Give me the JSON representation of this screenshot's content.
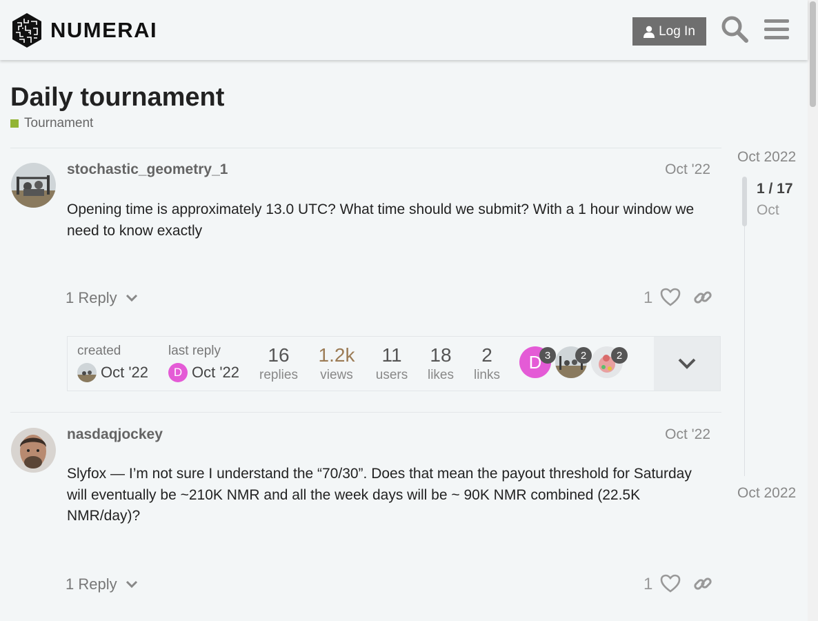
{
  "header": {
    "brand": "NUMERAI",
    "login_label": "Log In",
    "search_icon": "search-icon",
    "menu_icon": "hamburger-menu-icon"
  },
  "topic": {
    "title": "Daily tournament",
    "category": "Tournament",
    "category_color": "#92b434"
  },
  "posts": [
    {
      "username": "stochastic_geometry_1",
      "date": "Oct '22",
      "body": "Opening time is approximately 13.0 UTC? What time should we submit? With a 1 hour window we need to know exactly",
      "reply_label": "1 Reply",
      "likes": "1"
    },
    {
      "username": "nasdaqjockey",
      "date": "Oct '22",
      "body": "Slyfox — I’m not sure I understand the “70/30”. Does that mean the payout threshold for Saturday will eventually be ~210K NMR and all the week days will be ~ 90K NMR combined (22.5K NMR/day)?",
      "reply_label": "1 Reply",
      "likes": "1"
    }
  ],
  "topic_map": {
    "created_label": "created",
    "created_date": "Oct '22",
    "last_reply_label": "last reply",
    "last_reply_date": "Oct '22",
    "last_reply_avatar_letter": "D",
    "stats": [
      {
        "value": "16",
        "label": "replies"
      },
      {
        "value": "1.2k",
        "label": "views"
      },
      {
        "value": "11",
        "label": "users"
      },
      {
        "value": "18",
        "label": "likes"
      },
      {
        "value": "2",
        "label": "links"
      }
    ],
    "participants": [
      {
        "letter": "D",
        "count": "3"
      },
      {
        "letter": "",
        "count": "2"
      },
      {
        "letter": "",
        "count": "2"
      }
    ]
  },
  "timeline": {
    "start_date": "Oct 2022",
    "position": "1 / 17",
    "position_date": "Oct",
    "end_date": "Oct 2022"
  },
  "colors": {
    "views_highlight": "#9b7b55",
    "avatar_d": "#e45bd6",
    "login_bg": "#6f6f6f"
  }
}
